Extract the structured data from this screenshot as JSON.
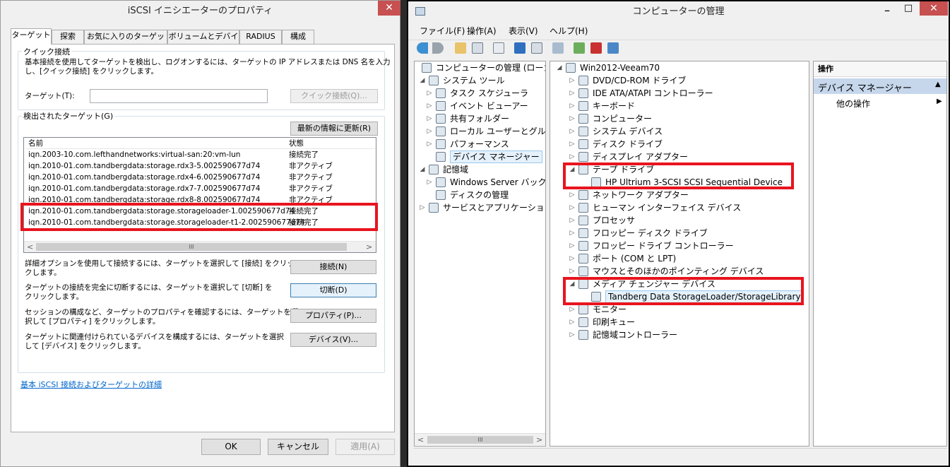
{
  "iscsi": {
    "title": "iSCSI イニシエーターのプロパティ",
    "close": "✕",
    "tabs": [
      "ターゲット",
      "探索",
      "お気に入りのターゲット",
      "ボリュームとデバイス",
      "RADIUS",
      "構成"
    ],
    "quick": {
      "group": "クイック接続",
      "desc1": "基本接続を使用してターゲットを検出し、ログオンするには、ターゲットの IP アドレスまたは DNS 名を入力",
      "desc2": "し、[クイック接続] をクリックします。",
      "target_label": "ターゲット(T):",
      "target_value": "",
      "button": "クイック接続(Q)..."
    },
    "discovered": {
      "group": "検出されたターゲット(G)",
      "refresh": "最新の情報に更新(R)",
      "col_name": "名前",
      "col_state": "状態",
      "rows": [
        {
          "name": "iqn.2003-10.com.lefthandnetworks:virtual-san:20:vm-lun",
          "state": "接続完了"
        },
        {
          "name": "iqn.2010-01.com.tandbergdata:storage.rdx3-5.002590677d74",
          "state": "非アクティブ"
        },
        {
          "name": "iqn.2010-01.com.tandbergdata:storage.rdx4-6.002590677d74",
          "state": "非アクティブ"
        },
        {
          "name": "iqn.2010-01.com.tandbergdata:storage.rdx7-7.002590677d74",
          "state": "非アクティブ"
        },
        {
          "name": "iqn.2010-01.com.tandbergdata:storage.rdx8-8.002590677d74",
          "state": "非アクティブ"
        },
        {
          "name": "iqn.2010-01.com.tandbergdata:storage.storageloader-1.002590677d74",
          "state": "接続完了"
        },
        {
          "name": "iqn.2010-01.com.tandbergdata:storage.storageloader-t1-2.002590677d74",
          "state": "接続完了"
        }
      ],
      "scroll_left": "<",
      "scroll_mid": "III",
      "scroll_right": ">"
    },
    "actions": [
      {
        "d1": "詳細オプションを使用して接続するには、ターゲットを選択して [接続] をクリッ",
        "d2": "クします。",
        "button": "接続(N)"
      },
      {
        "d1": "ターゲットの接続を完全に切断するには、ターゲットを選択して [切断] を",
        "d2": "クリックします。",
        "button": "切断(D)"
      },
      {
        "d1": "セッションの構成など、ターゲットのプロパティを確認するには、ターゲットを選",
        "d2": "択して [プロパティ] をクリックします。",
        "button": "プロパティ(P)..."
      },
      {
        "d1": "ターゲットに関連付けられているデバイスを構成するには、ターゲットを選択",
        "d2": "して [デバイス] をクリックします。",
        "button": "デバイス(V)..."
      }
    ],
    "link": "基本 iSCSI 接続およびターゲットの詳細",
    "ok": "OK",
    "cancel": "キャンセル",
    "apply": "適用(A)"
  },
  "mgmt": {
    "title": "コンピューターの管理",
    "controls": [
      "_",
      "□",
      "✕"
    ],
    "menu": [
      "ファイル(F)",
      "操作(A)",
      "表示(V)",
      "ヘルプ(H)"
    ],
    "left_tree": [
      {
        "label": "コンピューターの管理 (ローカル)",
        "tw": "",
        "depth": 0
      },
      {
        "label": "システム ツール",
        "tw": "◢",
        "depth": 1
      },
      {
        "label": "タスク スケジューラ",
        "tw": "▷",
        "depth": 2
      },
      {
        "label": "イベント ビューアー",
        "tw": "▷",
        "depth": 2
      },
      {
        "label": "共有フォルダー",
        "tw": "▷",
        "depth": 2
      },
      {
        "label": "ローカル ユーザーとグループ",
        "tw": "▷",
        "depth": 2
      },
      {
        "label": "パフォーマンス",
        "tw": "▷",
        "depth": 2
      },
      {
        "label": "デバイス マネージャー",
        "tw": "",
        "depth": 2
      },
      {
        "label": "記憶域",
        "tw": "◢",
        "depth": 1
      },
      {
        "label": "Windows Server バックアップ",
        "tw": "▷",
        "depth": 2
      },
      {
        "label": "ディスクの管理",
        "tw": "",
        "depth": 2
      },
      {
        "label": "サービスとアプリケーション",
        "tw": "▷",
        "depth": 1
      }
    ],
    "device_tree": [
      {
        "label": "Win2012-Veeam70",
        "tw": "◢",
        "depth": 0
      },
      {
        "label": "DVD/CD-ROM ドライブ",
        "tw": "▷",
        "depth": 1
      },
      {
        "label": "IDE ATA/ATAPI コントローラー",
        "tw": "▷",
        "depth": 1
      },
      {
        "label": "キーボード",
        "tw": "▷",
        "depth": 1
      },
      {
        "label": "コンピューター",
        "tw": "▷",
        "depth": 1
      },
      {
        "label": "システム デバイス",
        "tw": "▷",
        "depth": 1
      },
      {
        "label": "ディスク ドライブ",
        "tw": "▷",
        "depth": 1
      },
      {
        "label": "ディスプレイ アダプター",
        "tw": "▷",
        "depth": 1
      },
      {
        "label": "テープ ドライブ",
        "tw": "◢",
        "depth": 1
      },
      {
        "label": "HP Ultrium 3-SCSI SCSI Sequential Device",
        "tw": "",
        "depth": 2
      },
      {
        "label": "ネットワーク アダプター",
        "tw": "▷",
        "depth": 1
      },
      {
        "label": "ヒューマン インターフェイス デバイス",
        "tw": "▷",
        "depth": 1
      },
      {
        "label": "プロセッサ",
        "tw": "▷",
        "depth": 1
      },
      {
        "label": "フロッピー ディスク ドライブ",
        "tw": "▷",
        "depth": 1
      },
      {
        "label": "フロッピー ドライブ コントローラー",
        "tw": "▷",
        "depth": 1
      },
      {
        "label": "ポート (COM と LPT)",
        "tw": "▷",
        "depth": 1
      },
      {
        "label": "マウスとそのほかのポインティング デバイス",
        "tw": "▷",
        "depth": 1
      },
      {
        "label": "メディア チェンジャー デバイス",
        "tw": "◢",
        "depth": 1
      },
      {
        "label": "Tandberg Data StorageLoader/StorageLibrary",
        "tw": "",
        "depth": 2
      },
      {
        "label": "モニター",
        "tw": "▷",
        "depth": 1
      },
      {
        "label": "印刷キュー",
        "tw": "▷",
        "depth": 1
      },
      {
        "label": "記憶域コントローラー",
        "tw": "▷",
        "depth": 1
      }
    ],
    "ops_header": "操作",
    "ops_section": "デバイス マネージャー",
    "ops_more": "他の操作",
    "scroll_left": "<",
    "scroll_mid": "III",
    "scroll_right": ">"
  }
}
